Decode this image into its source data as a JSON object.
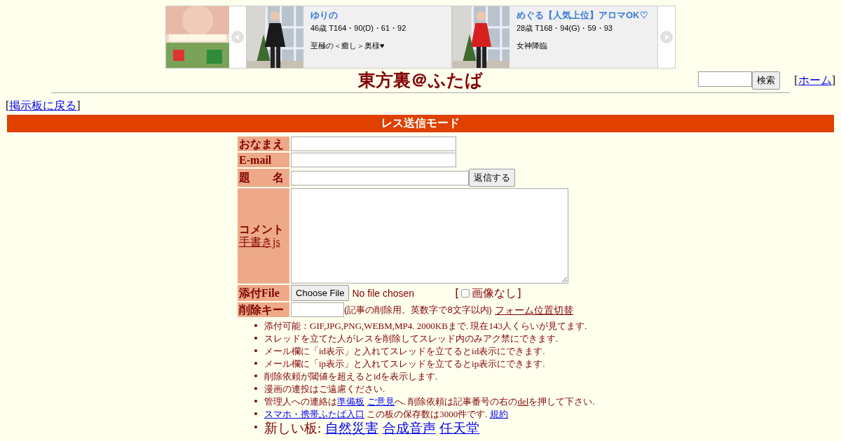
{
  "banner": {
    "cards": [
      {
        "name": "ゆりの",
        "stats": "46歳 T164・90(D)・61・92",
        "tagline": "至極の＜癒し＞奥様♥"
      },
      {
        "name": "めぐる【人気上位】アロマOK♡",
        "stats": "28歳 T168・94(G)・59・93",
        "tagline": "女神降臨"
      }
    ]
  },
  "header": {
    "title": "東方裏＠ふたば",
    "search_button": "検索",
    "home_link": {
      "open": "[",
      "text": "ホーム",
      "close": "]"
    }
  },
  "back_link": {
    "open": "[",
    "text": "掲示板に戻る",
    "close": "]"
  },
  "mode_bar": "レス送信モード",
  "form": {
    "name_label": "おなまえ",
    "email_label": "E-mail",
    "subject_label": "題　　名",
    "submit": "返信する",
    "comment_label": "コメント",
    "handwriting_link": "手書きjs",
    "file_label": "添付File",
    "file_button": "Choose File",
    "file_status": "No file chosen",
    "no_image": {
      "open": "[",
      "label": "画像なし",
      "close": "]",
      "checked": false
    },
    "delkey_label": "削除キー",
    "delkey_note": "(記事の削除用。英数字で8文字以内)",
    "form_position_link": "フォーム位置切替"
  },
  "notes": [
    {
      "kind": "small",
      "parts": [
        {
          "kind": "text",
          "text": "添付可能：GIF,JPG,PNG,WEBM,MP4. 2000KBまで. 現在143人くらいが見てます."
        }
      ]
    },
    {
      "kind": "small",
      "parts": [
        {
          "kind": "text",
          "text": "スレッドを立てた人がレスを削除してスレッド内のみアク禁にできます."
        }
      ]
    },
    {
      "kind": "small",
      "parts": [
        {
          "kind": "text",
          "text": "メール欄に「id表示」と入れてスレッドを立てるとid表示にできます."
        }
      ]
    },
    {
      "kind": "small",
      "parts": [
        {
          "kind": "text",
          "text": "メール欄に「ip表示」と入れてスレッドを立てるとip表示にできます."
        }
      ]
    },
    {
      "kind": "small",
      "parts": [
        {
          "kind": "text",
          "text": "削除依頼が閾値を超えるとidを表示します."
        }
      ]
    },
    {
      "kind": "small",
      "parts": [
        {
          "kind": "text",
          "text": "漫画の連投はご遠慮ください."
        }
      ]
    },
    {
      "kind": "small",
      "parts": [
        {
          "kind": "text",
          "text": "管理人への連絡は"
        },
        {
          "kind": "link",
          "text": "準備板"
        },
        {
          "kind": "link",
          "text": "ご意見"
        },
        {
          "kind": "text",
          "text": "へ. 削除依頼は記事番号の右の"
        },
        {
          "kind": "dellink",
          "text": "del"
        },
        {
          "kind": "text",
          "text": "を押して下さい."
        }
      ]
    },
    {
      "kind": "small",
      "parts": [
        {
          "kind": "link",
          "text": "スマホ・携帯ふたば入口"
        },
        {
          "kind": "text",
          "text": " この板の保存数は3000件です. "
        },
        {
          "kind": "link",
          "text": "規約"
        }
      ]
    },
    {
      "kind": "large",
      "parts": [
        {
          "kind": "text",
          "text": "新しい板:"
        },
        {
          "kind": "link",
          "text": "自然災害"
        },
        {
          "kind": "link",
          "text": "合成音声"
        },
        {
          "kind": "link",
          "text": "任天堂"
        }
      ]
    }
  ]
}
